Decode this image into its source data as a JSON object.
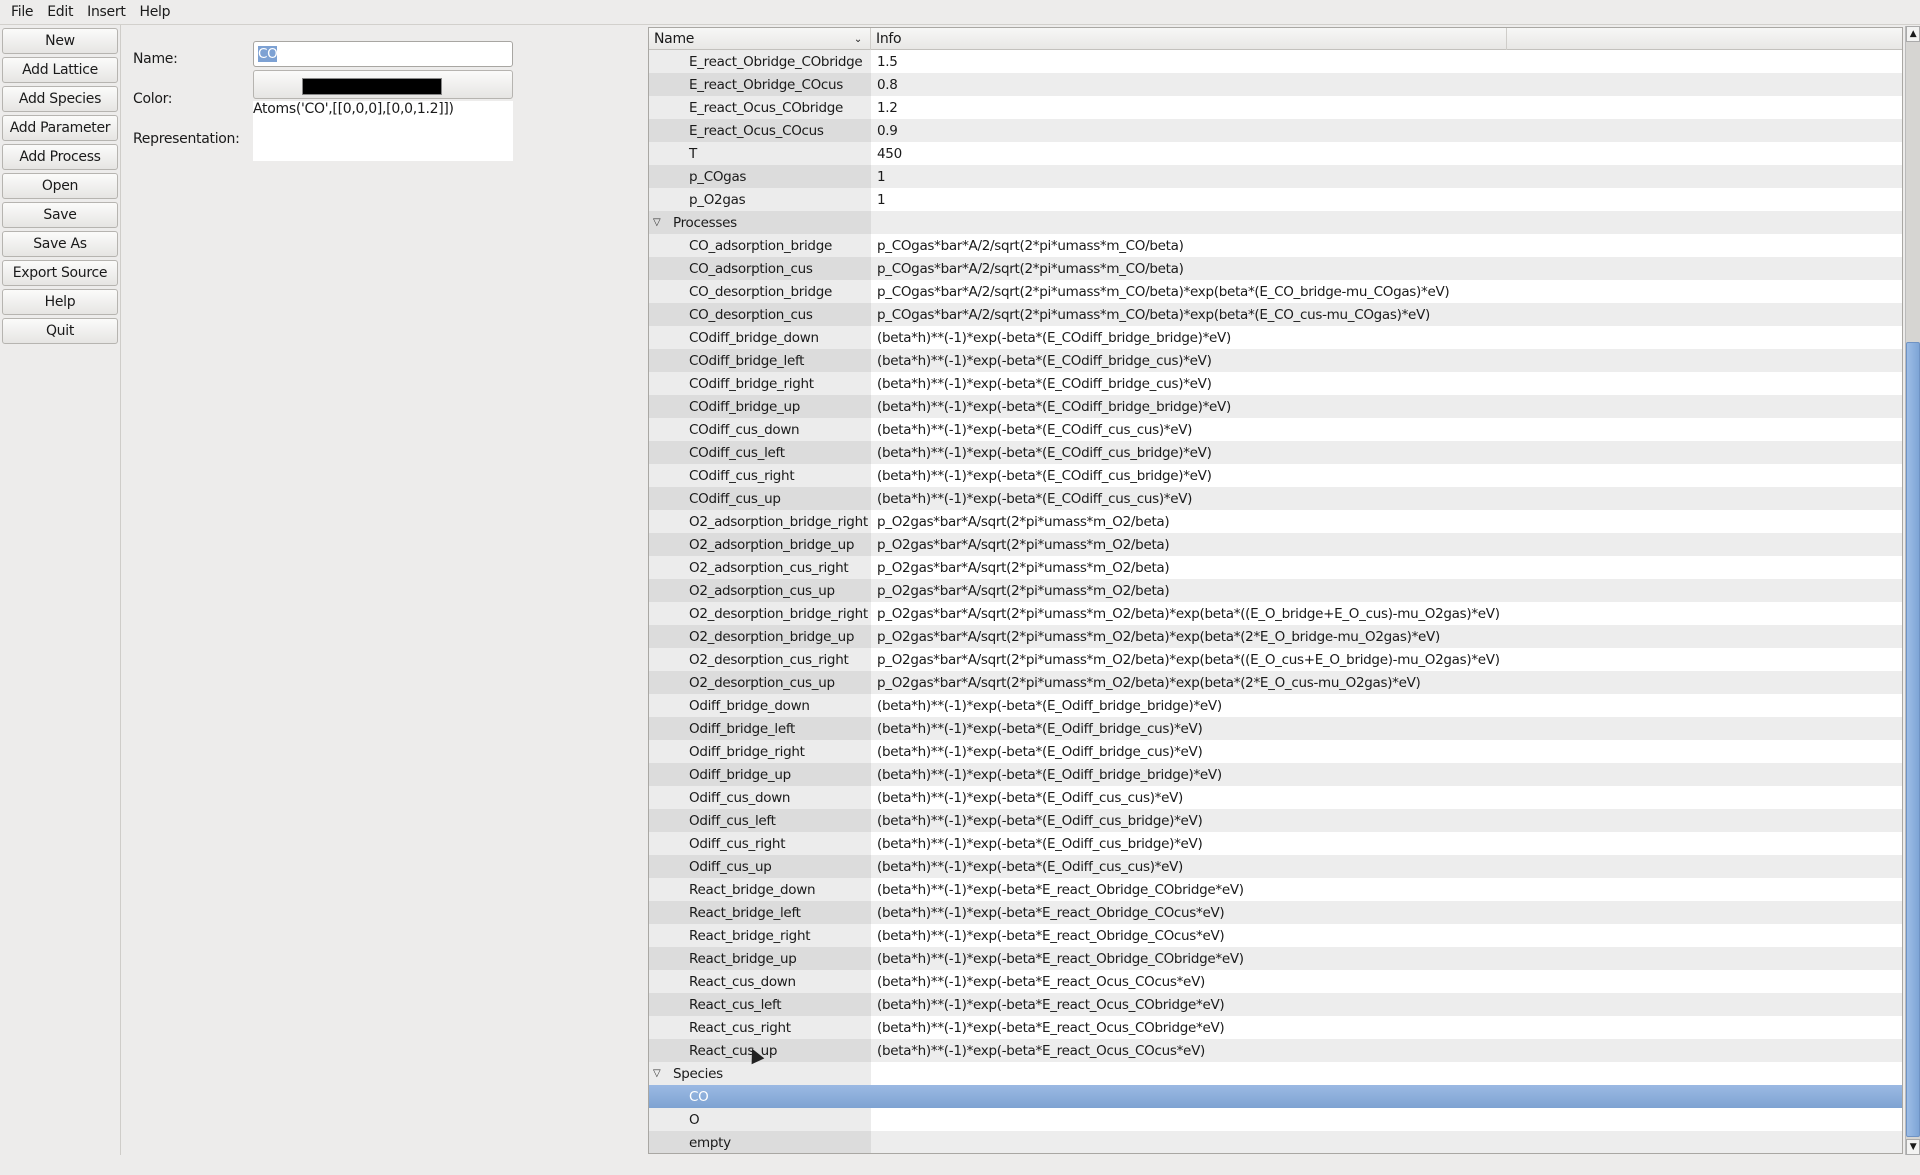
{
  "menu": [
    "File",
    "Edit",
    "Insert",
    "Help"
  ],
  "buttons": [
    "New",
    "Add Lattice",
    "Add Species",
    "Add Parameter",
    "Add Process",
    "Open",
    "Save",
    "Save As",
    "Export Source",
    "Help",
    "Quit"
  ],
  "form": {
    "name_label": "Name:",
    "name_value": "CO",
    "color_label": "Color:",
    "color_value": "#000000",
    "representation_label": "Representation:",
    "representation_value": "Atoms('CO',[[0,0,0],[0,0,1.2]])"
  },
  "tree": {
    "columns": [
      "Name",
      "Info"
    ],
    "rows": [
      {
        "name": "E_react_Obridge_CObridge",
        "info": "1.5"
      },
      {
        "name": "E_react_Obridge_COcus",
        "info": "0.8"
      },
      {
        "name": "E_react_Ocus_CObridge",
        "info": "1.2"
      },
      {
        "name": "E_react_Ocus_COcus",
        "info": "0.9"
      },
      {
        "name": "T",
        "info": "450"
      },
      {
        "name": "p_COgas",
        "info": "1"
      },
      {
        "name": "p_O2gas",
        "info": "1"
      },
      {
        "name": "Processes",
        "info": "",
        "category": true
      },
      {
        "name": "CO_adsorption_bridge",
        "info": "p_COgas*bar*A/2/sqrt(2*pi*umass*m_CO/beta)"
      },
      {
        "name": "CO_adsorption_cus",
        "info": "p_COgas*bar*A/2/sqrt(2*pi*umass*m_CO/beta)"
      },
      {
        "name": "CO_desorption_bridge",
        "info": "p_COgas*bar*A/2/sqrt(2*pi*umass*m_CO/beta)*exp(beta*(E_CO_bridge-mu_COgas)*eV)"
      },
      {
        "name": "CO_desorption_cus",
        "info": "p_COgas*bar*A/2/sqrt(2*pi*umass*m_CO/beta)*exp(beta*(E_CO_cus-mu_COgas)*eV)"
      },
      {
        "name": "COdiff_bridge_down",
        "info": "(beta*h)**(-1)*exp(-beta*(E_COdiff_bridge_bridge)*eV)"
      },
      {
        "name": "COdiff_bridge_left",
        "info": "(beta*h)**(-1)*exp(-beta*(E_COdiff_bridge_cus)*eV)"
      },
      {
        "name": "COdiff_bridge_right",
        "info": "(beta*h)**(-1)*exp(-beta*(E_COdiff_bridge_cus)*eV)"
      },
      {
        "name": "COdiff_bridge_up",
        "info": "(beta*h)**(-1)*exp(-beta*(E_COdiff_bridge_bridge)*eV)"
      },
      {
        "name": "COdiff_cus_down",
        "info": "(beta*h)**(-1)*exp(-beta*(E_COdiff_cus_cus)*eV)"
      },
      {
        "name": "COdiff_cus_left",
        "info": "(beta*h)**(-1)*exp(-beta*(E_COdiff_cus_bridge)*eV)"
      },
      {
        "name": "COdiff_cus_right",
        "info": "(beta*h)**(-1)*exp(-beta*(E_COdiff_cus_bridge)*eV)"
      },
      {
        "name": "COdiff_cus_up",
        "info": "(beta*h)**(-1)*exp(-beta*(E_COdiff_cus_cus)*eV)"
      },
      {
        "name": "O2_adsorption_bridge_right",
        "info": "p_O2gas*bar*A/sqrt(2*pi*umass*m_O2/beta)"
      },
      {
        "name": "O2_adsorption_bridge_up",
        "info": "p_O2gas*bar*A/sqrt(2*pi*umass*m_O2/beta)"
      },
      {
        "name": "O2_adsorption_cus_right",
        "info": "p_O2gas*bar*A/sqrt(2*pi*umass*m_O2/beta)"
      },
      {
        "name": "O2_adsorption_cus_up",
        "info": "p_O2gas*bar*A/sqrt(2*pi*umass*m_O2/beta)"
      },
      {
        "name": "O2_desorption_bridge_right",
        "info": "p_O2gas*bar*A/sqrt(2*pi*umass*m_O2/beta)*exp(beta*((E_O_bridge+E_O_cus)-mu_O2gas)*eV)"
      },
      {
        "name": "O2_desorption_bridge_up",
        "info": "p_O2gas*bar*A/sqrt(2*pi*umass*m_O2/beta)*exp(beta*(2*E_O_bridge-mu_O2gas)*eV)"
      },
      {
        "name": "O2_desorption_cus_right",
        "info": "p_O2gas*bar*A/sqrt(2*pi*umass*m_O2/beta)*exp(beta*((E_O_cus+E_O_bridge)-mu_O2gas)*eV)"
      },
      {
        "name": "O2_desorption_cus_up",
        "info": "p_O2gas*bar*A/sqrt(2*pi*umass*m_O2/beta)*exp(beta*(2*E_O_cus-mu_O2gas)*eV)"
      },
      {
        "name": "Odiff_bridge_down",
        "info": "(beta*h)**(-1)*exp(-beta*(E_Odiff_bridge_bridge)*eV)"
      },
      {
        "name": "Odiff_bridge_left",
        "info": "(beta*h)**(-1)*exp(-beta*(E_Odiff_bridge_cus)*eV)"
      },
      {
        "name": "Odiff_bridge_right",
        "info": "(beta*h)**(-1)*exp(-beta*(E_Odiff_bridge_cus)*eV)"
      },
      {
        "name": "Odiff_bridge_up",
        "info": "(beta*h)**(-1)*exp(-beta*(E_Odiff_bridge_bridge)*eV)"
      },
      {
        "name": "Odiff_cus_down",
        "info": "(beta*h)**(-1)*exp(-beta*(E_Odiff_cus_cus)*eV)"
      },
      {
        "name": "Odiff_cus_left",
        "info": "(beta*h)**(-1)*exp(-beta*(E_Odiff_cus_bridge)*eV)"
      },
      {
        "name": "Odiff_cus_right",
        "info": "(beta*h)**(-1)*exp(-beta*(E_Odiff_cus_bridge)*eV)"
      },
      {
        "name": "Odiff_cus_up",
        "info": "(beta*h)**(-1)*exp(-beta*(E_Odiff_cus_cus)*eV)"
      },
      {
        "name": "React_bridge_down",
        "info": "(beta*h)**(-1)*exp(-beta*E_react_Obridge_CObridge*eV)"
      },
      {
        "name": "React_bridge_left",
        "info": "(beta*h)**(-1)*exp(-beta*E_react_Obridge_COcus*eV)"
      },
      {
        "name": "React_bridge_right",
        "info": "(beta*h)**(-1)*exp(-beta*E_react_Obridge_COcus*eV)"
      },
      {
        "name": "React_bridge_up",
        "info": "(beta*h)**(-1)*exp(-beta*E_react_Obridge_CObridge*eV)"
      },
      {
        "name": "React_cus_down",
        "info": "(beta*h)**(-1)*exp(-beta*E_react_Ocus_COcus*eV)"
      },
      {
        "name": "React_cus_left",
        "info": "(beta*h)**(-1)*exp(-beta*E_react_Ocus_CObridge*eV)"
      },
      {
        "name": "React_cus_right",
        "info": "(beta*h)**(-1)*exp(-beta*E_react_Ocus_CObridge*eV)"
      },
      {
        "name": "React_cus_up",
        "info": "(beta*h)**(-1)*exp(-beta*E_react_Ocus_COcus*eV)"
      },
      {
        "name": "Species",
        "info": "",
        "category": true
      },
      {
        "name": "CO",
        "info": "",
        "selected": true
      },
      {
        "name": "O",
        "info": ""
      },
      {
        "name": "empty",
        "info": ""
      }
    ]
  },
  "icons": {
    "expand": "triangle-down-icon",
    "sort": "chevron-down-icon",
    "scroll_up": "arrow-up-icon",
    "scroll_down": "arrow-down-icon"
  },
  "colors": {
    "selection": "#86abd9"
  }
}
